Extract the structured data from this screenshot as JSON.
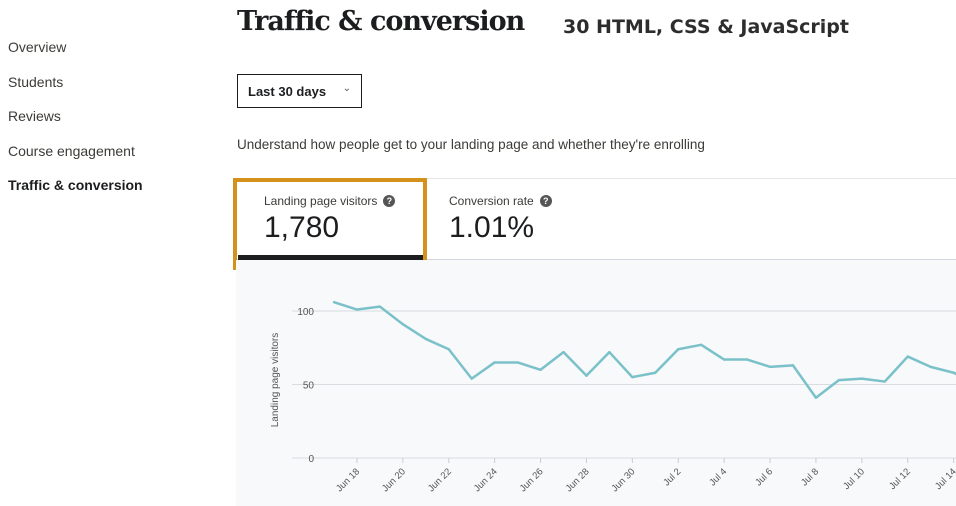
{
  "sidebar": {
    "items": [
      {
        "label": "Overview",
        "active": false
      },
      {
        "label": "Students",
        "active": false
      },
      {
        "label": "Reviews",
        "active": false
      },
      {
        "label": "Course engagement",
        "active": false
      },
      {
        "label": "Traffic & conversion",
        "active": true
      }
    ]
  },
  "header": {
    "title": "Traffic & conversion",
    "watermark": "30 HTML, CSS & JavaScript"
  },
  "range_select": {
    "value": "Last 30 days",
    "icon": "chevron-down-icon"
  },
  "description": "Understand how people get to your landing page and whether they're enrolling",
  "metrics": [
    {
      "label": "Landing page visitors",
      "value": "1,780",
      "selected": true,
      "icon": "help-icon"
    },
    {
      "label": "Conversion rate",
      "value": "1.01%",
      "selected": false,
      "icon": "help-icon"
    }
  ],
  "colors": {
    "highlight": "#d4921c",
    "line": "#7bc1c9",
    "chart_bg": "#f7f9fa"
  },
  "chart_data": {
    "type": "line",
    "xlabel": "",
    "ylabel": "Landing page visitors",
    "ylim": [
      0,
      110
    ],
    "yticks": [
      0,
      50,
      100
    ],
    "grid": true,
    "xtick_labels": [
      "Jun 18",
      "Jun 20",
      "Jun 22",
      "Jun 24",
      "Jun 26",
      "Jun 28",
      "Jun 30",
      "Jul 2",
      "Jul 4",
      "Jul 6",
      "Jul 8",
      "Jul 10",
      "Jul 12",
      "Jul 14"
    ],
    "x": [
      "Jun 17",
      "Jun 18",
      "Jun 19",
      "Jun 20",
      "Jun 21",
      "Jun 22",
      "Jun 23",
      "Jun 24",
      "Jun 25",
      "Jun 26",
      "Jun 27",
      "Jun 28",
      "Jun 29",
      "Jun 30",
      "Jul 1",
      "Jul 2",
      "Jul 3",
      "Jul 4",
      "Jul 5",
      "Jul 6",
      "Jul 7",
      "Jul 8",
      "Jul 9",
      "Jul 10",
      "Jul 11",
      "Jul 12",
      "Jul 13",
      "Jul 14"
    ],
    "values": [
      106,
      101,
      103,
      91,
      81,
      74,
      54,
      65,
      65,
      60,
      72,
      56,
      72,
      55,
      58,
      74,
      77,
      67,
      67,
      62,
      63,
      41,
      53,
      54,
      52,
      69,
      62,
      58
    ]
  }
}
